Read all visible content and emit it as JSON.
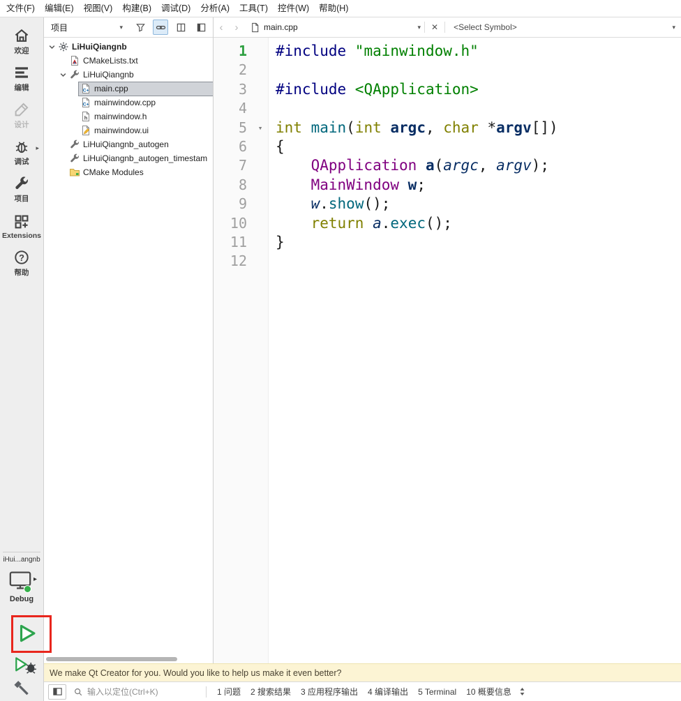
{
  "menu_bar": {
    "items": [
      "文件(F)",
      "编辑(E)",
      "视图(V)",
      "构建(B)",
      "调试(D)",
      "分析(A)",
      "工具(T)",
      "控件(W)",
      "帮助(H)"
    ]
  },
  "mode_sidebar": {
    "modes": [
      {
        "id": "welcome",
        "label": "欢迎",
        "icon": "home-icon",
        "disabled": false,
        "has_arrow": false
      },
      {
        "id": "edit",
        "label": "编辑",
        "icon": "edit-icon",
        "disabled": false,
        "has_arrow": false
      },
      {
        "id": "design",
        "label": "设计",
        "icon": "design-icon",
        "disabled": true,
        "has_arrow": false
      },
      {
        "id": "debug",
        "label": "调试",
        "icon": "debug-icon",
        "disabled": false,
        "has_arrow": true
      },
      {
        "id": "projects",
        "label": "项目",
        "icon": "wrench-icon",
        "disabled": false,
        "has_arrow": false
      },
      {
        "id": "extensions",
        "label": "Extensions",
        "icon": "extensions-icon",
        "disabled": false,
        "has_arrow": false
      },
      {
        "id": "help",
        "label": "帮助",
        "icon": "help-icon",
        "disabled": false,
        "has_arrow": false
      }
    ],
    "kit_label": "iHui...angnb",
    "build_config": "Debug"
  },
  "project_panel": {
    "selector_label": "项目",
    "tree": [
      {
        "id": "project-root",
        "label": "LiHuiQiangnb",
        "level": 0,
        "icon": "project-root-icon",
        "bold": true,
        "expanded": true,
        "selected": false
      },
      {
        "id": "cmakelists",
        "label": "CMakeLists.txt",
        "level": 1,
        "icon": "cmake-file-icon",
        "bold": false,
        "expanded": false,
        "selected": false
      },
      {
        "id": "subproject",
        "label": "LiHuiQiangnb",
        "level": 1,
        "icon": "wrench-small-icon",
        "bold": false,
        "expanded": true,
        "selected": false
      },
      {
        "id": "main-cpp",
        "label": "main.cpp",
        "level": 2,
        "icon": "cpp-file-icon",
        "bold": false,
        "expanded": false,
        "selected": true
      },
      {
        "id": "mainwindow-cpp",
        "label": "mainwindow.cpp",
        "level": 2,
        "icon": "cpp-file-icon",
        "bold": false,
        "expanded": false,
        "selected": false
      },
      {
        "id": "mainwindow-h",
        "label": "mainwindow.h",
        "level": 2,
        "icon": "h-file-icon",
        "bold": false,
        "expanded": false,
        "selected": false
      },
      {
        "id": "mainwindow-ui",
        "label": "mainwindow.ui",
        "level": 2,
        "icon": "ui-file-icon",
        "bold": false,
        "expanded": false,
        "selected": false
      },
      {
        "id": "autogen",
        "label": "LiHuiQiangnb_autogen",
        "level": 1,
        "icon": "wrench-small-icon",
        "bold": false,
        "expanded": false,
        "selected": false
      },
      {
        "id": "autogen-timestamp",
        "label": "LiHuiQiangnb_autogen_timestam",
        "level": 1,
        "icon": "wrench-small-icon",
        "bold": false,
        "expanded": false,
        "selected": false
      },
      {
        "id": "cmake-modules",
        "label": "CMake Modules",
        "level": 1,
        "icon": "folder-icon",
        "bold": false,
        "expanded": false,
        "selected": false
      }
    ]
  },
  "editor": {
    "toolbar": {
      "document_label": "main.cpp",
      "symbol_label": "<Select Symbol>"
    },
    "code_lines": [
      {
        "num": "1",
        "green": true,
        "fold": false,
        "segments": [
          {
            "t": "#include ",
            "c": "pp"
          },
          {
            "t": "\"mainwindow.h\"",
            "c": "str"
          }
        ]
      },
      {
        "num": "2",
        "green": false,
        "fold": false,
        "segments": []
      },
      {
        "num": "3",
        "green": false,
        "fold": false,
        "segments": [
          {
            "t": "#include ",
            "c": "pp"
          },
          {
            "t": "<QApplication>",
            "c": "str"
          }
        ]
      },
      {
        "num": "4",
        "green": false,
        "fold": false,
        "segments": []
      },
      {
        "num": "5",
        "green": false,
        "fold": true,
        "segments": [
          {
            "t": "int ",
            "c": "kw"
          },
          {
            "t": "main",
            "c": "fn"
          },
          {
            "t": "("
          },
          {
            "t": "int ",
            "c": "kw"
          },
          {
            "t": "argc",
            "c": "decl"
          },
          {
            "t": ", "
          },
          {
            "t": "char ",
            "c": "kw"
          },
          {
            "t": "*"
          },
          {
            "t": "argv",
            "c": "decl"
          },
          {
            "t": "[])"
          }
        ]
      },
      {
        "num": "6",
        "green": false,
        "fold": false,
        "segments": [
          {
            "t": "{"
          }
        ]
      },
      {
        "num": "7",
        "green": false,
        "fold": false,
        "segments": [
          {
            "t": "    "
          },
          {
            "t": "QApplication",
            "c": "type"
          },
          {
            "t": " "
          },
          {
            "t": "a",
            "c": "decl"
          },
          {
            "t": "("
          },
          {
            "t": "argc",
            "c": "loc"
          },
          {
            "t": ", "
          },
          {
            "t": "argv",
            "c": "loc"
          },
          {
            "t": ");"
          }
        ]
      },
      {
        "num": "8",
        "green": false,
        "fold": false,
        "segments": [
          {
            "t": "    "
          },
          {
            "t": "MainWindow",
            "c": "type"
          },
          {
            "t": " "
          },
          {
            "t": "w",
            "c": "decl"
          },
          {
            "t": ";"
          }
        ]
      },
      {
        "num": "9",
        "green": false,
        "fold": false,
        "segments": [
          {
            "t": "    "
          },
          {
            "t": "w",
            "c": "loc"
          },
          {
            "t": "."
          },
          {
            "t": "show",
            "c": "fn"
          },
          {
            "t": "();"
          }
        ]
      },
      {
        "num": "10",
        "green": false,
        "fold": false,
        "segments": [
          {
            "t": "    "
          },
          {
            "t": "return ",
            "c": "kw"
          },
          {
            "t": "a",
            "c": "loc"
          },
          {
            "t": "."
          },
          {
            "t": "exec",
            "c": "fn"
          },
          {
            "t": "();"
          }
        ]
      },
      {
        "num": "11",
        "green": false,
        "fold": false,
        "segments": [
          {
            "t": "}"
          }
        ]
      },
      {
        "num": "12",
        "green": false,
        "fold": false,
        "segments": []
      }
    ]
  },
  "notification_bar": {
    "message": "We make Qt Creator for you. Would you like to help us make it even better?"
  },
  "status_bar": {
    "locator_placeholder": "输入以定位(Ctrl+K)",
    "panes": [
      {
        "label": "1 问题"
      },
      {
        "label": "2 搜索结果"
      },
      {
        "label": "3 应用程序输出"
      },
      {
        "label": "4 编译输出"
      },
      {
        "label": "5 Terminal"
      },
      {
        "label": "10 概要信息"
      }
    ]
  },
  "colors": {
    "annotation_red": "#e8261d",
    "run_green": "#2da44e",
    "preprocessor": "#000080",
    "string": "#008000",
    "keyword": "#808000",
    "type": "#800080",
    "function": "#00677c",
    "local": "#092e64",
    "changed_line_number": "#2fa042"
  }
}
